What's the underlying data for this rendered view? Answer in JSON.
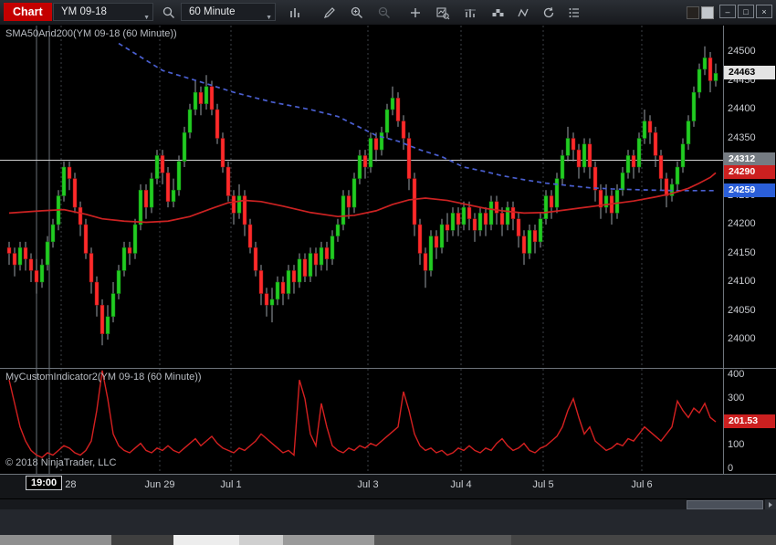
{
  "toolbar": {
    "chart_label": "Chart",
    "instrument": "YM 09-18",
    "interval": "60 Minute",
    "icons": [
      "instrument-lookup-icon",
      "bar-type-icon",
      "draw-pencil-icon",
      "zoom-in-icon",
      "zoom-out-icon",
      "add-icon",
      "chart-trader-icon",
      "data-series-icon",
      "indicators-blocks-icon",
      "zigzag-icon",
      "reload-icon",
      "properties-list-icon"
    ]
  },
  "window_controls": [
    {
      "name": "minimize",
      "glyph": "–"
    },
    {
      "name": "maximize",
      "glyph": "□"
    },
    {
      "name": "close",
      "glyph": "×"
    }
  ],
  "main_panel": {
    "label": "SMA50And200(YM 09-18 (60 Minute))"
  },
  "indicator_panel": {
    "label": "MyCustomIndicator2(YM 09-18 (60 Minute))",
    "copyright": "© 2018 NinjaTrader, LLC"
  },
  "price_axis": {
    "labels": [
      24500,
      24450,
      24400,
      24350,
      24300,
      24250,
      24200,
      24150,
      24100,
      24050,
      24000
    ],
    "tags": [
      {
        "value": "24463",
        "price": 24463,
        "bg": "#e3e3e3",
        "fg": "#000000"
      },
      {
        "value": "24312",
        "price": 24312,
        "bg": "#757b82",
        "fg": "#ffffff"
      },
      {
        "value": "24290",
        "price": 24290,
        "bg": "#cc2020",
        "fg": "#ffffff"
      },
      {
        "value": "24259",
        "price": 24259,
        "bg": "#2b5fd9",
        "fg": "#ffffff"
      }
    ]
  },
  "indicator_axis": {
    "labels": [
      400,
      300,
      200,
      100,
      0
    ],
    "tag": {
      "value": "201.53",
      "level": 201.53,
      "bg": "#cc2020",
      "fg": "#ffffff"
    }
  },
  "time_axis": {
    "cursor_time": "19:00",
    "sessions": [
      {
        "label": "Jun 28",
        "i": 10
      },
      {
        "label": "Jun 29",
        "i": 28
      },
      {
        "label": "Jul 1",
        "i": 41
      },
      {
        "label": "Jul 3",
        "i": 66
      },
      {
        "label": "Jul 4",
        "i": 83
      },
      {
        "label": "Jul 5",
        "i": 98
      },
      {
        "label": "Jul 6",
        "i": 116
      }
    ]
  },
  "tabs": {
    "items": [
      {
        "label": "YM 09-18"
      }
    ],
    "add_label": "+"
  },
  "chart_data": {
    "type": "candlestick",
    "instrument": "YM 09-18",
    "interval": "60 Minute",
    "price_range": [
      24000,
      24500
    ],
    "horizontal_line": 24312,
    "last_price": 24463,
    "colors": {
      "up": "#22cc22",
      "down": "#ff2a2a",
      "wick": "#9aa0a6",
      "sma50": "#cc2222",
      "sma200": "#4a5fd0",
      "indicator": "#d42020"
    },
    "layout": {
      "cursor_lines_x": [
        40,
        54
      ],
      "legend_position": "top-left",
      "grid": "vertical-dashed-only"
    },
    "candles": [
      [
        24160,
        24170,
        24130,
        24150
      ],
      [
        24150,
        24160,
        24110,
        24130
      ],
      [
        24130,
        24170,
        24120,
        24160
      ],
      [
        24160,
        24170,
        24120,
        24140
      ],
      [
        24140,
        24150,
        24100,
        24120
      ],
      [
        24120,
        24140,
        24080,
        24100
      ],
      [
        24100,
        24140,
        24090,
        24130
      ],
      [
        24130,
        24180,
        24120,
        24170
      ],
      [
        24170,
        24210,
        24160,
        24200
      ],
      [
        24200,
        24260,
        24190,
        24250
      ],
      [
        24250,
        24310,
        24240,
        24300
      ],
      [
        24300,
        24310,
        24260,
        24280
      ],
      [
        24280,
        24290,
        24220,
        24230
      ],
      [
        24230,
        24240,
        24180,
        24200
      ],
      [
        24200,
        24210,
        24140,
        24150
      ],
      [
        24150,
        24160,
        24080,
        24100
      ],
      [
        24100,
        24110,
        24040,
        24060
      ],
      [
        24060,
        24070,
        23990,
        24010
      ],
      [
        24010,
        24060,
        24000,
        24040
      ],
      [
        24040,
        24100,
        24030,
        24080
      ],
      [
        24080,
        24130,
        24070,
        24120
      ],
      [
        24120,
        24170,
        24110,
        24160
      ],
      [
        24160,
        24170,
        24130,
        24150
      ],
      [
        24150,
        24210,
        24140,
        24200
      ],
      [
        24200,
        24270,
        24190,
        24260
      ],
      [
        24260,
        24270,
        24210,
        24230
      ],
      [
        24230,
        24290,
        24220,
        24280
      ],
      [
        24280,
        24330,
        24270,
        24320
      ],
      [
        24320,
        24330,
        24270,
        24290
      ],
      [
        24290,
        24300,
        24230,
        24240
      ],
      [
        24240,
        24280,
        24230,
        24260
      ],
      [
        24260,
        24320,
        24250,
        24310
      ],
      [
        24310,
        24370,
        24300,
        24360
      ],
      [
        24360,
        24410,
        24350,
        24400
      ],
      [
        24400,
        24450,
        24390,
        24430
      ],
      [
        24430,
        24440,
        24390,
        24410
      ],
      [
        24410,
        24460,
        24400,
        24440
      ],
      [
        24440,
        24450,
        24390,
        24400
      ],
      [
        24400,
        24410,
        24340,
        24350
      ],
      [
        24350,
        24360,
        24290,
        24300
      ],
      [
        24300,
        24310,
        24240,
        24250
      ],
      [
        24250,
        24260,
        24200,
        24220
      ],
      [
        24220,
        24270,
        24210,
        24250
      ],
      [
        24250,
        24260,
        24180,
        24200
      ],
      [
        24200,
        24210,
        24150,
        24160
      ],
      [
        24160,
        24170,
        24110,
        24120
      ],
      [
        24120,
        24130,
        24060,
        24080
      ],
      [
        24080,
        24090,
        24040,
        24060
      ],
      [
        24060,
        24090,
        24030,
        24070
      ],
      [
        24070,
        24110,
        24060,
        24100
      ],
      [
        24100,
        24110,
        24060,
        24080
      ],
      [
        24080,
        24130,
        24070,
        24120
      ],
      [
        24120,
        24130,
        24080,
        24100
      ],
      [
        24100,
        24150,
        24090,
        24140
      ],
      [
        24140,
        24150,
        24100,
        24110
      ],
      [
        24110,
        24160,
        24100,
        24150
      ],
      [
        24150,
        24160,
        24110,
        24130
      ],
      [
        24130,
        24170,
        24120,
        24160
      ],
      [
        24160,
        24170,
        24120,
        24140
      ],
      [
        24140,
        24190,
        24130,
        24180
      ],
      [
        24180,
        24210,
        24170,
        24200
      ],
      [
        24200,
        24260,
        24190,
        24250
      ],
      [
        24250,
        24260,
        24210,
        24230
      ],
      [
        24230,
        24290,
        24220,
        24280
      ],
      [
        24280,
        24330,
        24270,
        24320
      ],
      [
        24320,
        24330,
        24280,
        24300
      ],
      [
        24300,
        24360,
        24290,
        24350
      ],
      [
        24350,
        24360,
        24310,
        24330
      ],
      [
        24330,
        24370,
        24320,
        24360
      ],
      [
        24360,
        24410,
        24350,
        24400
      ],
      [
        24400,
        24440,
        24390,
        24420
      ],
      [
        24420,
        24430,
        24370,
        24380
      ],
      [
        24380,
        24390,
        24330,
        24350
      ],
      [
        24350,
        24360,
        24260,
        24280
      ],
      [
        24280,
        24290,
        24180,
        24200
      ],
      [
        24200,
        24210,
        24130,
        24150
      ],
      [
        24150,
        24160,
        24090,
        24120
      ],
      [
        24120,
        24190,
        24110,
        24180
      ],
      [
        24180,
        24190,
        24140,
        24160
      ],
      [
        24160,
        24210,
        24150,
        24200
      ],
      [
        24200,
        24220,
        24170,
        24190
      ],
      [
        24190,
        24230,
        24180,
        24220
      ],
      [
        24220,
        24230,
        24180,
        24200
      ],
      [
        24200,
        24240,
        24190,
        24230
      ],
      [
        24230,
        24240,
        24190,
        24210
      ],
      [
        24210,
        24220,
        24170,
        24190
      ],
      [
        24190,
        24230,
        24180,
        24220
      ],
      [
        24220,
        24230,
        24180,
        24200
      ],
      [
        24200,
        24250,
        24190,
        24240
      ],
      [
        24240,
        24250,
        24200,
        24220
      ],
      [
        24220,
        24230,
        24180,
        24200
      ],
      [
        24200,
        24240,
        24190,
        24230
      ],
      [
        24230,
        24240,
        24190,
        24210
      ],
      [
        24210,
        24220,
        24160,
        24180
      ],
      [
        24180,
        24190,
        24130,
        24150
      ],
      [
        24150,
        24200,
        24140,
        24190
      ],
      [
        24190,
        24200,
        24150,
        24170
      ],
      [
        24170,
        24220,
        24160,
        24210
      ],
      [
        24210,
        24260,
        24200,
        24250
      ],
      [
        24250,
        24260,
        24210,
        24230
      ],
      [
        24230,
        24290,
        24220,
        24280
      ],
      [
        24280,
        24330,
        24270,
        24320
      ],
      [
        24320,
        24370,
        24310,
        24350
      ],
      [
        24350,
        24360,
        24310,
        24330
      ],
      [
        24330,
        24340,
        24280,
        24300
      ],
      [
        24300,
        24350,
        24290,
        24340
      ],
      [
        24340,
        24350,
        24280,
        24300
      ],
      [
        24300,
        24310,
        24240,
        24260
      ],
      [
        24260,
        24270,
        24210,
        24230
      ],
      [
        24230,
        24270,
        24220,
        24250
      ],
      [
        24250,
        24260,
        24200,
        24220
      ],
      [
        24220,
        24270,
        24210,
        24260
      ],
      [
        24260,
        24300,
        24250,
        24290
      ],
      [
        24290,
        24330,
        24280,
        24320
      ],
      [
        24320,
        24330,
        24280,
        24300
      ],
      [
        24300,
        24360,
        24290,
        24350
      ],
      [
        24350,
        24400,
        24340,
        24380
      ],
      [
        24380,
        24390,
        24340,
        24360
      ],
      [
        24360,
        24370,
        24300,
        24320
      ],
      [
        24320,
        24330,
        24260,
        24280
      ],
      [
        24280,
        24290,
        24230,
        24250
      ],
      [
        24250,
        24280,
        24240,
        24270
      ],
      [
        24270,
        24310,
        24260,
        24300
      ],
      [
        24300,
        24350,
        24290,
        24340
      ],
      [
        24340,
        24390,
        24330,
        24380
      ],
      [
        24380,
        24440,
        24370,
        24430
      ],
      [
        24430,
        24480,
        24420,
        24470
      ],
      [
        24470,
        24510,
        24460,
        24490
      ],
      [
        24490,
        24500,
        24430,
        24450
      ],
      [
        24450,
        24480,
        24440,
        24463
      ]
    ],
    "sma200": [
      [
        20,
        24515
      ],
      [
        28,
        24468
      ],
      [
        35,
        24448
      ],
      [
        41,
        24430
      ],
      [
        48,
        24413
      ],
      [
        55,
        24400
      ],
      [
        60,
        24388
      ],
      [
        67,
        24355
      ],
      [
        71,
        24345
      ],
      [
        75,
        24330
      ],
      [
        79,
        24318
      ],
      [
        83,
        24300
      ],
      [
        87,
        24292
      ],
      [
        90,
        24285
      ],
      [
        94,
        24278
      ],
      [
        98,
        24272
      ],
      [
        103,
        24267
      ],
      [
        106,
        24264
      ],
      [
        110,
        24262
      ],
      [
        117,
        24260
      ],
      [
        122,
        24259
      ],
      [
        129,
        24259
      ]
    ],
    "sma50": [
      [
        0,
        24220
      ],
      [
        6,
        24224
      ],
      [
        10,
        24226
      ],
      [
        14,
        24218
      ],
      [
        17,
        24210
      ],
      [
        21,
        24206
      ],
      [
        25,
        24204
      ],
      [
        29,
        24206
      ],
      [
        33,
        24214
      ],
      [
        37,
        24228
      ],
      [
        40,
        24238
      ],
      [
        43,
        24242
      ],
      [
        46,
        24240
      ],
      [
        50,
        24232
      ],
      [
        55,
        24221
      ],
      [
        60,
        24214
      ],
      [
        63,
        24216
      ],
      [
        67,
        24224
      ],
      [
        70,
        24235
      ],
      [
        73,
        24243
      ],
      [
        76,
        24246
      ],
      [
        80,
        24242
      ],
      [
        83,
        24236
      ],
      [
        87,
        24228
      ],
      [
        90,
        24224
      ],
      [
        94,
        24220
      ],
      [
        98,
        24221
      ],
      [
        102,
        24226
      ],
      [
        106,
        24231
      ],
      [
        110,
        24236
      ],
      [
        114,
        24241
      ],
      [
        118,
        24248
      ],
      [
        121,
        24254
      ],
      [
        124,
        24263
      ],
      [
        126,
        24272
      ],
      [
        128,
        24282
      ],
      [
        129,
        24290
      ]
    ],
    "indicator": {
      "name": "MyCustomIndicator2",
      "range": [
        0,
        400
      ],
      "last_value": 201.53,
      "values": [
        380,
        280,
        180,
        120,
        80,
        60,
        50,
        70,
        60,
        80,
        100,
        90,
        70,
        60,
        80,
        120,
        250,
        420,
        300,
        150,
        100,
        80,
        70,
        90,
        110,
        80,
        70,
        90,
        80,
        100,
        80,
        70,
        90,
        110,
        130,
        100,
        120,
        140,
        110,
        90,
        80,
        70,
        90,
        80,
        100,
        120,
        150,
        130,
        110,
        90,
        70,
        80,
        60,
        380,
        300,
        150,
        100,
        280,
        180,
        100,
        80,
        70,
        90,
        80,
        100,
        90,
        110,
        100,
        120,
        140,
        160,
        180,
        330,
        250,
        150,
        100,
        80,
        90,
        70,
        80,
        60,
        70,
        90,
        80,
        100,
        80,
        70,
        90,
        80,
        110,
        130,
        100,
        80,
        90,
        110,
        80,
        70,
        90,
        100,
        120,
        140,
        180,
        250,
        300,
        220,
        150,
        180,
        120,
        100,
        80,
        90,
        110,
        100,
        130,
        120,
        150,
        180,
        160,
        140,
        120,
        150,
        180,
        290,
        250,
        220,
        260,
        240,
        280,
        220,
        201.53
      ]
    }
  }
}
